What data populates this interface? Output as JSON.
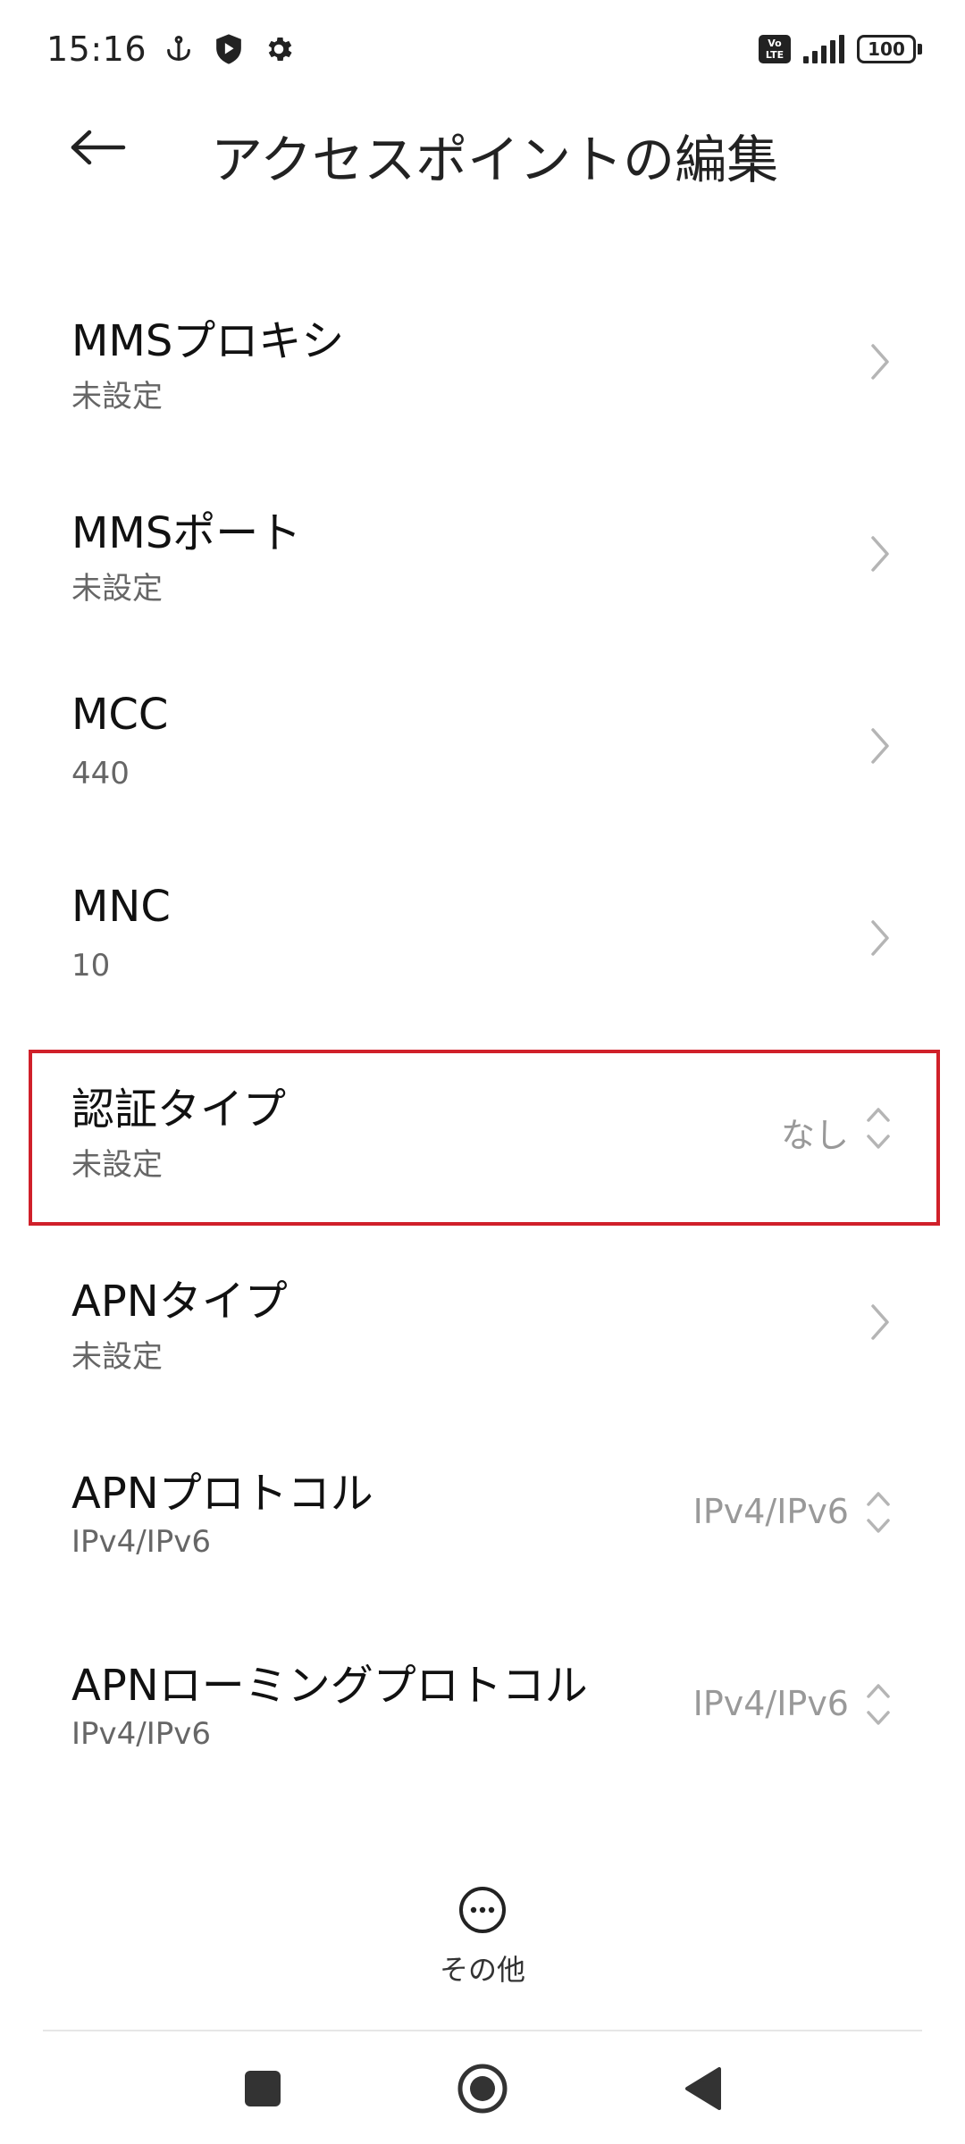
{
  "status_bar": {
    "time": "15:16",
    "volte_top": "Vo",
    "volte_bottom": "LTE",
    "battery": "100"
  },
  "header": {
    "title": "アクセスポイントの編集"
  },
  "items": [
    {
      "title": "MMSプロキシ",
      "subtitle": "未設定"
    },
    {
      "title": "MMSポート",
      "subtitle": "未設定"
    },
    {
      "title": "MCC",
      "subtitle": "440"
    },
    {
      "title": "MNC",
      "subtitle": "10"
    },
    {
      "title": "認証タイプ",
      "subtitle": "未設定",
      "value": "なし"
    },
    {
      "title": "APNタイプ",
      "subtitle": "未設定"
    },
    {
      "title": "APNプロトコル",
      "subtitle": "IPv4/IPv6",
      "value": "IPv4/IPv6"
    },
    {
      "title": "APNローミングプロトコル",
      "subtitle": "IPv4/IPv6",
      "value": "IPv4/IPv6"
    }
  ],
  "more": {
    "label": "その他"
  },
  "colors": {
    "highlight": "#d0202a",
    "text_primary": "#111111",
    "text_secondary": "#666666",
    "value_text": "#999999"
  }
}
